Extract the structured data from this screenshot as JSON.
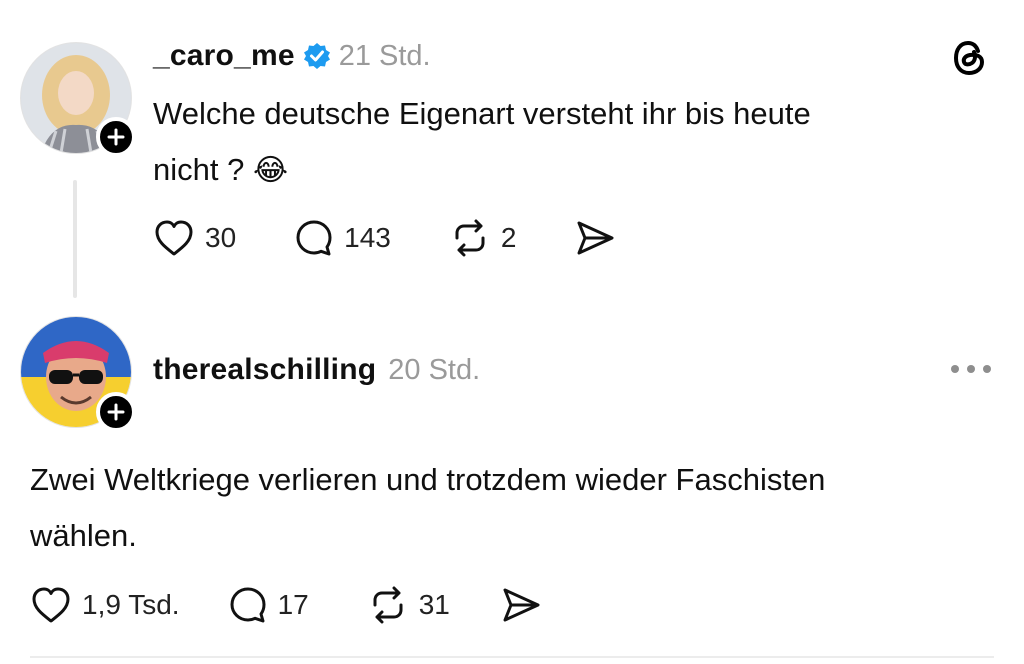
{
  "post1": {
    "username": "_caro_me",
    "verified": true,
    "time": "21 Std.",
    "text_line1": "Welche deutsche Eigenart versteht ihr bis heute",
    "text_line2": "nicht ?",
    "emoji": "😂",
    "likes": "30",
    "replies": "143",
    "reposts": "2"
  },
  "post2": {
    "username": "therealschilling",
    "time": "20 Std.",
    "text_line1": "Zwei Weltkriege verlieren und trotzdem wieder Faschisten",
    "text_line2": "wählen.",
    "likes": "1,9 Tsd.",
    "replies": "17",
    "reposts": "31"
  },
  "colors": {
    "verified_blue": "#1d9bf0",
    "muted_text": "#9a9a9a",
    "thread_line": "#e6e6e6"
  },
  "icons": [
    "threads-logo-icon",
    "heart-icon",
    "comment-icon",
    "repost-icon",
    "share-icon",
    "more-icon",
    "plus-icon",
    "verified-badge-icon"
  ]
}
